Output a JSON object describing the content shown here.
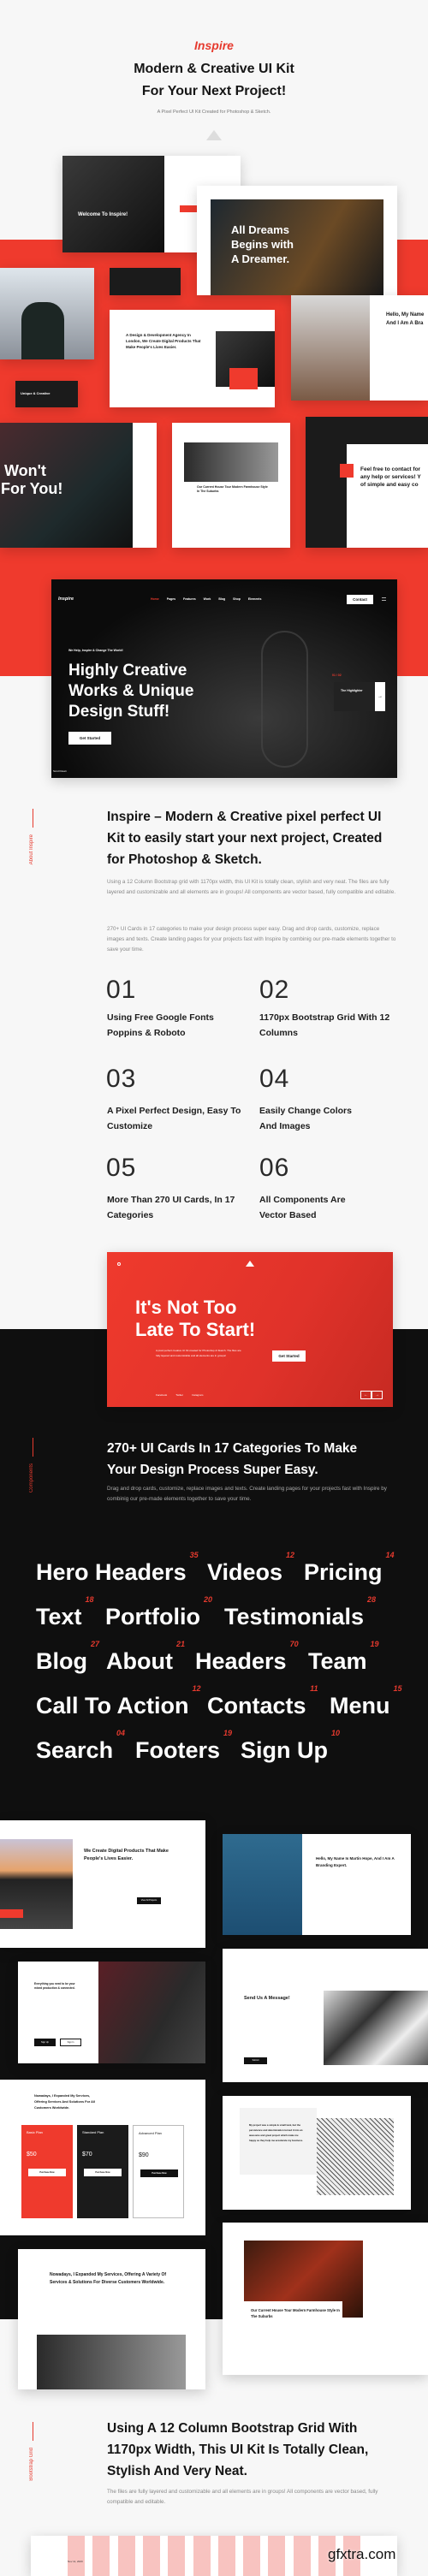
{
  "header": {
    "brand": "Inspire",
    "title_line1": "Modern & Creative UI Kit",
    "title_line2": "For Your Next Project!",
    "subtitle": "A Pixel Perfect UI Kit Created for Photoshop & Sketch."
  },
  "colors": {
    "accent": "#ef3a2d",
    "dark": "#111111",
    "light": "#f7f7f7"
  },
  "collage": {
    "welcome_title": "Welcome To Inspire!",
    "dreams_title": [
      "All Dreams",
      "Begins with",
      "A Dreamer."
    ],
    "agency_title": "A Design & Development Agency In London, We Create Digital Products That Make People's Lives Easier.",
    "hello_title": [
      "Hello, My Name",
      "And I Am A Bra"
    ],
    "wont_title": [
      "Won't",
      "For You!"
    ],
    "blog_title": "Our Current House Tour Modern Farmhouse Style In The Suburbs",
    "contact_title": [
      "Feel free to contact for",
      "any help or services! Y",
      "of simple and easy co"
    ],
    "unique_label": "Unique & Creative"
  },
  "hero_mockup": {
    "logo": "Inspire",
    "nav": [
      "Home",
      "Pages",
      "Features",
      "Work",
      "Blog",
      "Shop",
      "Elements"
    ],
    "contact_button": "Contact",
    "eyebrow": "We Help, Inspire & Change The World!",
    "title": [
      "Highly Creative",
      "Works & Unique",
      "Design Stuff!"
    ],
    "cta": "Get Started",
    "scroll": "Scroll Down",
    "slide_counter": "01 / 02",
    "slide_card_title": "The Highlighter"
  },
  "about": {
    "side_label": "About Inspire",
    "heading": "Inspire – Modern & Creative pixel perfect UI Kit to easily start your next project, Created for Photoshop & Sketch.",
    "para1": "Using a 12 Column Bootstrap grid with 1170px width, this UI Kit is totally clean, stylish and very neat. The files are fully layered and customizable and all elements are in groups! All components are vector based, fully compatible and editable.",
    "para2": "270+ UI Cards in 17 categories to make your design process super easy. Drag and drop cards, customize, replace images and texts. Create landing pages for your projects fast with Inspire by combinig our pre-made elements together to save your time."
  },
  "features": [
    {
      "num": "01",
      "title": "Using Free Google Fonts Poppins & Roboto"
    },
    {
      "num": "02",
      "title": "1170px Bootstrap Grid With 12 Columns"
    },
    {
      "num": "03",
      "title": "A Pixel Perfect Design, Easy To Customize"
    },
    {
      "num": "04",
      "title": "Easily Change Colors And Images"
    },
    {
      "num": "05",
      "title": "More Than 270 UI Cards, In 17 Categories"
    },
    {
      "num": "06",
      "title": "All Components Are Vector Based"
    }
  ],
  "cta_card": {
    "title_line1": "It's Not Too",
    "title_line2": "Late To Start!",
    "text": "A pixel perfect creative UI Kit created for Photoshop & Sketch. The files are fully layered and customizable and all elements are in groups!",
    "button": "Get Started",
    "social": [
      "Facebook",
      "Twitter",
      "Instagram"
    ]
  },
  "components": {
    "side_label": "Components",
    "heading": "270+ UI Cards In 17 Categories To Make Your Design Process Super Easy.",
    "para": "Drag and drop cards, customize, replace images and texts. Create landing pages for your projects fast with Inspire by combinig our pre-made elements together to save your time.",
    "categories": [
      {
        "name": "Hero Headers",
        "count": "35"
      },
      {
        "name": "Videos",
        "count": "12"
      },
      {
        "name": "Pricing",
        "count": "14"
      },
      {
        "name": "Text",
        "count": "18"
      },
      {
        "name": "Portfolio",
        "count": "20"
      },
      {
        "name": "Testimonials",
        "count": "28"
      },
      {
        "name": "Blog",
        "count": "27"
      },
      {
        "name": "About",
        "count": "21"
      },
      {
        "name": "Headers",
        "count": "70"
      },
      {
        "name": "Team",
        "count": "19"
      },
      {
        "name": "Call To Action",
        "count": "12"
      },
      {
        "name": "Contacts",
        "count": "11"
      },
      {
        "name": "Menu",
        "count": "15"
      },
      {
        "name": "Search",
        "count": "04"
      },
      {
        "name": "Footers",
        "count": "19"
      },
      {
        "name": "Sign Up",
        "count": "10"
      }
    ]
  },
  "showcase": {
    "about_title": "We Create Digital Products That Make People's Lives Easier.",
    "about_button": "View All Projects",
    "hello_title": "Hello, My Name Is Martin Hope, And I Am A Branding Expert.",
    "signup_title": "Everything you need to be your mixed production & connected.",
    "signup_buttons": [
      "Sign Up",
      "Sign In"
    ],
    "message_title": "Send Us A Message!",
    "message_button": "Submit",
    "services_title": "Nowadays, I Expanded My Services, Offering Services And Solutions For All Customers Worldwide.",
    "plans": [
      {
        "name": "Basic Plan",
        "price": "$50"
      },
      {
        "name": "Standard Plan",
        "price": "$70"
      },
      {
        "name": "Advanced Plan",
        "price": "$90"
      }
    ],
    "plan_button": "Purchase Now",
    "testimonial": "My project was a simple & small task, but the persistence and determination turned it into an awesome and great project which make me happy as they help me accelerate my business.",
    "services2_title": "Nowadays, I Expanded My Services, Offering A Variety Of Services & Solutions For Diverse Customers Worldwide.",
    "blog_title": "Our Current House Tour Modern Farmhouse Style In The Suburbs"
  },
  "grid_section": {
    "side_label": "Bootstrap Grid",
    "heading": "Using A 12 Column Bootstrap Grid With 1170px Width, This UI Kit Is Totally Clean, Stylish And Very Neat.",
    "para": "The files are fully layered and customizable and all elements are in groups! All components are vector based, fully compatible and editable.",
    "date": "Nov 11, 2020",
    "watermark": "gfxtra.com"
  }
}
